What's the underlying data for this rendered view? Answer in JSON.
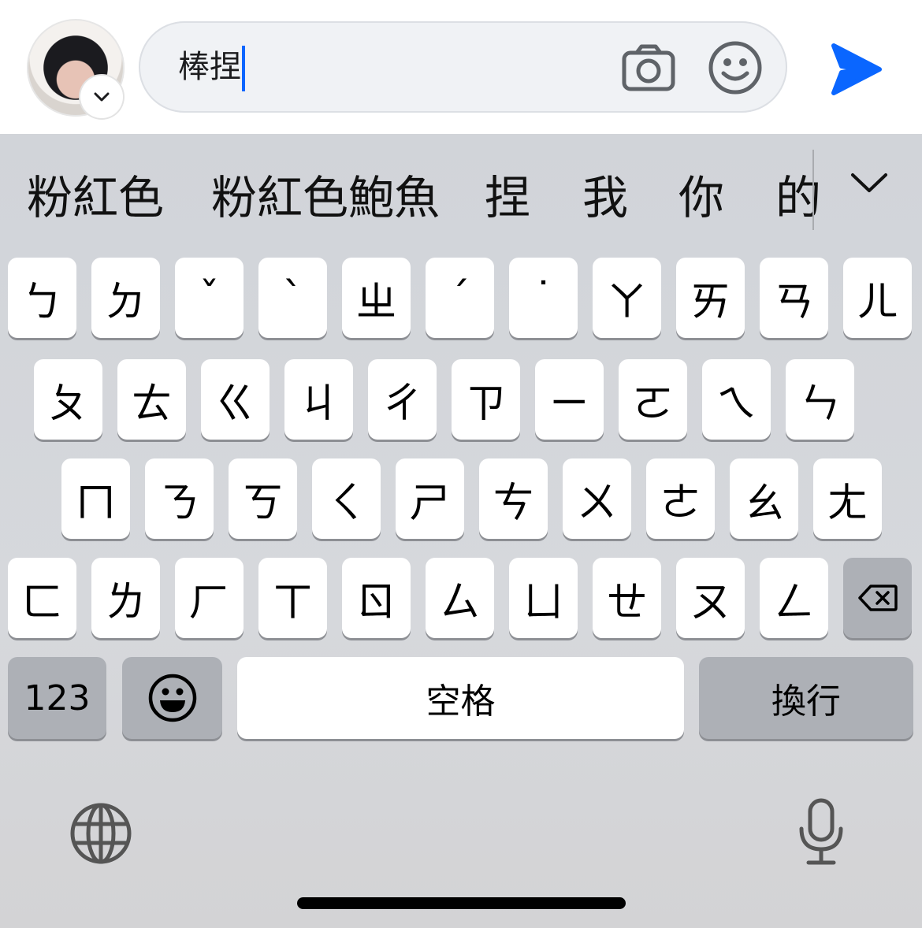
{
  "composer": {
    "input_value": "棒捏",
    "avatar_icon": "profile-photo",
    "camera_icon": "camera-icon",
    "emoji_icon": "smiley-icon",
    "send_icon": "send-arrow-icon",
    "accent_color": "#0a66ff"
  },
  "suggestions": {
    "items": [
      "粉紅色",
      "粉紅色鮑魚",
      "捏",
      "我",
      "你",
      "的"
    ],
    "expand_icon": "chevron-down-icon"
  },
  "keyboard": {
    "row1": [
      "ㄅ",
      "ㄉ",
      "ˇ",
      "ˋ",
      "ㄓ",
      "ˊ",
      "˙",
      "ㄚ",
      "ㄞ",
      "ㄢ",
      "ㄦ"
    ],
    "row2": [
      "ㄆ",
      "ㄊ",
      "ㄍ",
      "ㄐ",
      "ㄔ",
      "ㄗ",
      "ㄧ",
      "ㄛ",
      "ㄟ",
      "ㄣ"
    ],
    "row3": [
      "ㄇ",
      "ㄋ",
      "ㄎ",
      "ㄑ",
      "ㄕ",
      "ㄘ",
      "ㄨ",
      "ㄜ",
      "ㄠ",
      "ㄤ"
    ],
    "row4": [
      "ㄈ",
      "ㄌ",
      "ㄏ",
      "ㄒ",
      "ㄖ",
      "ㄙ",
      "ㄩ",
      "ㄝ",
      "ㄡ",
      "ㄥ"
    ],
    "numbers_label": "123",
    "space_label": "空格",
    "return_label": "換行",
    "delete_icon": "backspace-icon",
    "emoji_key_icon": "emoji-icon",
    "globe_icon": "globe-icon",
    "mic_icon": "microphone-icon"
  }
}
